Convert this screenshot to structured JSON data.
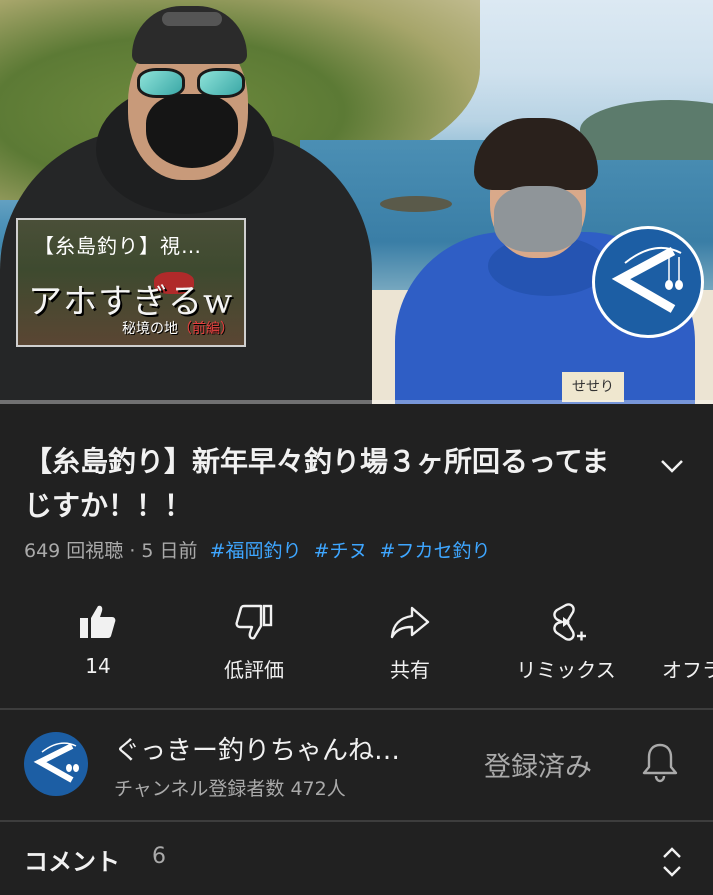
{
  "video": {
    "card": {
      "title": "【糸島釣り】視…",
      "big_text": "アホすぎるw",
      "sub_text": "秘境の地",
      "sub_highlight": "（前編）"
    },
    "shirt_tag": "せせり"
  },
  "info": {
    "title": "【糸島釣り】新年早々釣り場３ヶ所回るってまじすか！！！",
    "meta": "649 回視聴 · 5 日前",
    "tags": [
      "#福岡釣り",
      "#チヌ",
      "#フカセ釣り"
    ]
  },
  "actions": [
    {
      "icon": "thumbs-up-icon",
      "label": "14"
    },
    {
      "icon": "thumbs-down-icon",
      "label": "低評価"
    },
    {
      "icon": "share-icon",
      "label": "共有"
    },
    {
      "icon": "remix-icon",
      "label": "リミックス"
    },
    {
      "icon": "download-icon",
      "label": "オフラ"
    }
  ],
  "channel": {
    "name": "ぐっきー釣りちゃんね…",
    "subscribers": "チャンネル登録者数 472人",
    "subscribe_label": "登録済み"
  },
  "comments": {
    "label": "コメント",
    "count": "6"
  },
  "colors": {
    "background": "#212121",
    "text": "#f1f1f1",
    "secondary_text": "#aaaaaa",
    "hashtag": "#3ea6ff",
    "logo_blue": "#1c5ea4"
  }
}
